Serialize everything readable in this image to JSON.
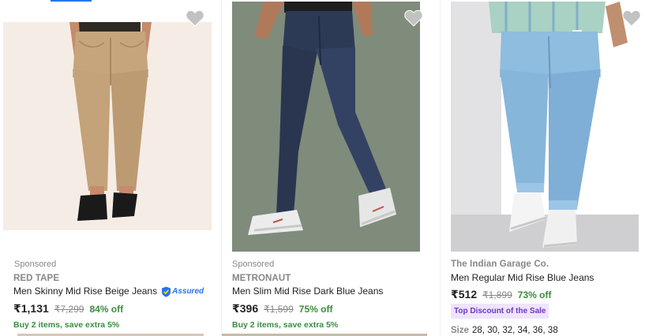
{
  "colors": {
    "accent": "#2874f0",
    "discount_green": "#388e3c",
    "muted_text": "#878787",
    "badge_bg": "#efe4fd",
    "badge_text": "#6c37c2"
  },
  "products": [
    {
      "sponsored": "Sponsored",
      "brand": "RED TAPE",
      "title": "Men Skinny Mid Rise Beige Jeans",
      "assured_label": "Assured",
      "price": "₹1,131",
      "mrp": "₹7,299",
      "discount": "84% off",
      "offer": "Buy 2 items, save extra 5%",
      "wishlist_icon": "heart-icon"
    },
    {
      "sponsored": "Sponsored",
      "brand": "METRONAUT",
      "title": "Men Slim Mid Rise Dark Blue Jeans",
      "price": "₹396",
      "mrp": "₹1,599",
      "discount": "75% off",
      "offer": "Buy 2 items, save extra 5%",
      "wishlist_icon": "heart-icon"
    },
    {
      "brand": "The Indian Garage Co.",
      "title": "Men Regular Mid Rise Blue Jeans",
      "price": "₹512",
      "mrp": "₹1,899",
      "discount": "73% off",
      "badge": "Top Discount of the Sale",
      "size_label": "Size",
      "sizes": "28, 30, 32, 34, 36, 38",
      "wishlist_icon": "heart-icon"
    }
  ]
}
